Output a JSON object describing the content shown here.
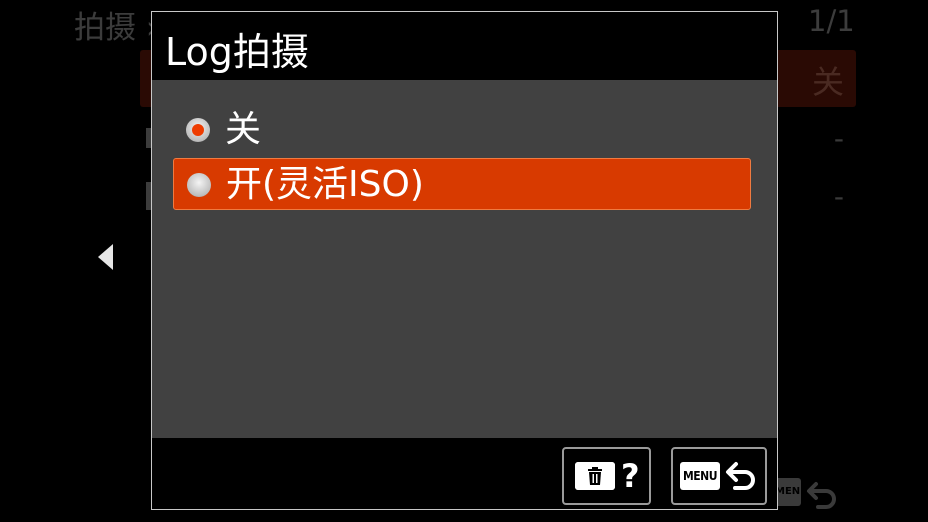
{
  "background_menu": {
    "title": "拍摄 › 影像质量/记录 ›   拍摄设置",
    "page_indicator": "1/1",
    "selected_row_value": "关",
    "row_2_value": "-",
    "row_3_value": "-",
    "menu_key_label": "MENU"
  },
  "dialog": {
    "title": "Log拍摄",
    "options": [
      {
        "label": "关",
        "selected": true
      },
      {
        "label": "开(灵活ISO)",
        "selected": false,
        "highlighted": true
      }
    ],
    "help_button": {
      "icon": "trash-icon",
      "label": "?"
    },
    "back_button": {
      "key_label": "MENU",
      "icon": "return-icon"
    }
  },
  "colors": {
    "highlight": "#d83a00",
    "radio_selected_dot": "#ee3c00",
    "dialog_body": "#414141",
    "dialog_border": "#c8c8c8"
  }
}
